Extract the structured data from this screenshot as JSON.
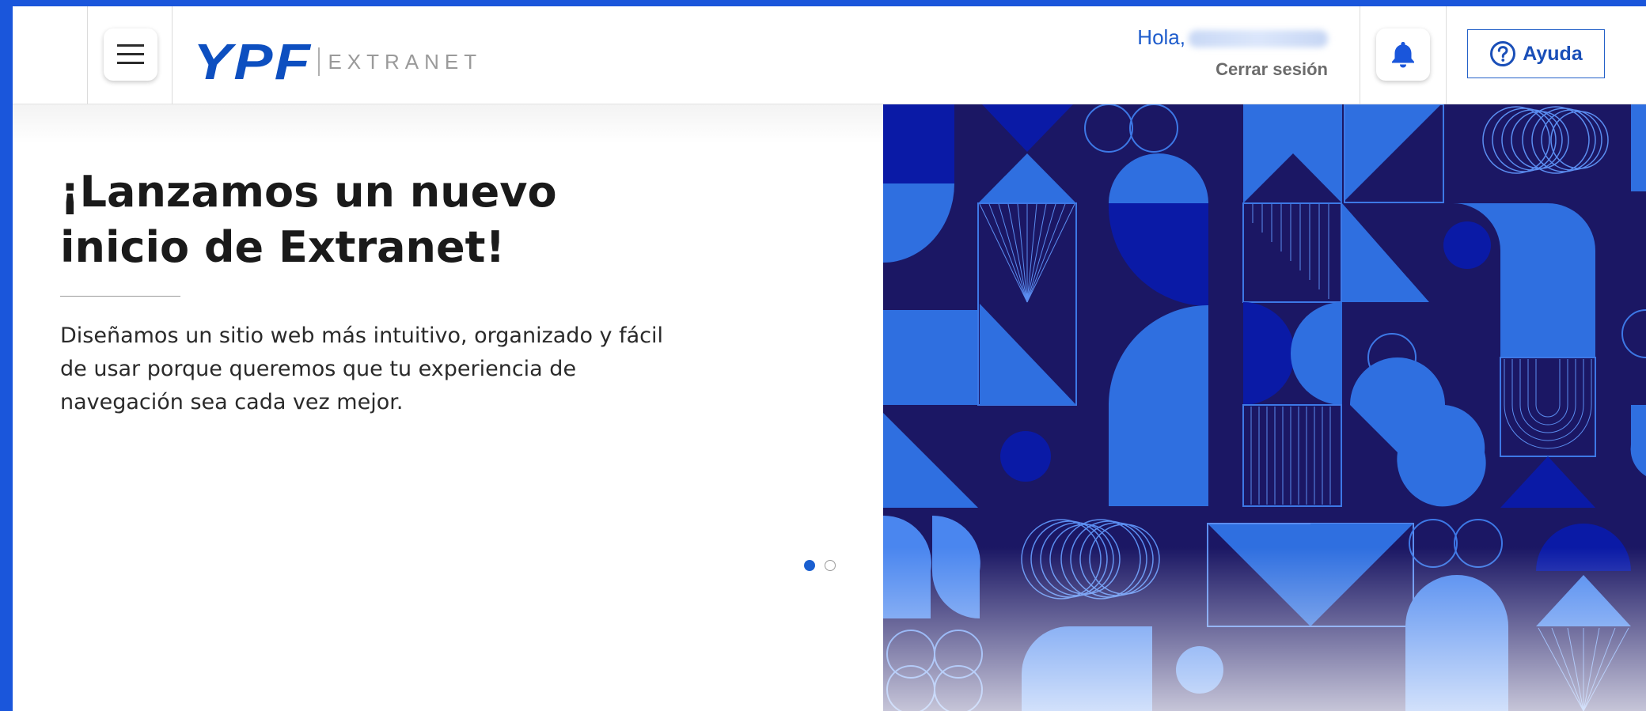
{
  "header": {
    "menu_icon": "hamburger-menu-icon",
    "logo_brand": "YPF",
    "logo_product": "EXTRANET",
    "greeting": "Hola,",
    "logout_label": "Cerrar sesión",
    "notifications_icon": "bell-icon",
    "help_icon": "question-circle-icon",
    "help_label": "Ayuda"
  },
  "hero": {
    "title": "¡Lanzamos un nuevo inicio de Extranet!",
    "description": "Diseñamos un sitio web más intuitivo, organizado y fácil de usar porque queremos que tu experiencia de navegación sea cada vez mejor.",
    "carousel_active_index": 0,
    "carousel_count": 2
  },
  "colors": {
    "frame": "#1a56db",
    "brand_blue": "#0d4fc0",
    "art_background": "#1b1764",
    "art_accent": "#2f6fe0",
    "art_dark": "#0a1aa6"
  }
}
